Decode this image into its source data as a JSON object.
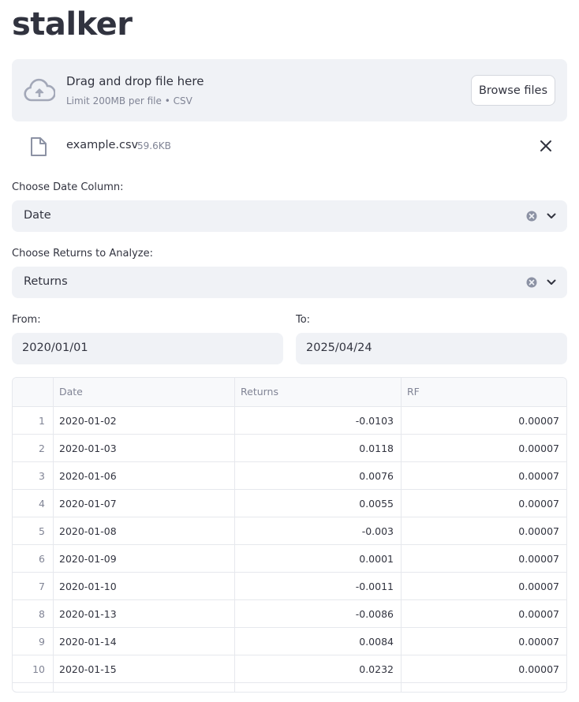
{
  "app": {
    "title": "stalker"
  },
  "uploader": {
    "main_text": "Drag and drop file here",
    "sub_text": "Limit 200MB per file • CSV",
    "browse_label": "Browse files"
  },
  "file": {
    "name": "example.csv",
    "size": "59.6KB"
  },
  "date_column": {
    "label": "Choose Date Column:",
    "value": "Date"
  },
  "returns_column": {
    "label": "Choose Returns to Analyze:",
    "value": "Returns"
  },
  "from": {
    "label": "From:",
    "value": "2020/01/01"
  },
  "to": {
    "label": "To:",
    "value": "2025/04/24"
  },
  "table": {
    "columns": [
      "Date",
      "Returns",
      "RF"
    ],
    "rows": [
      {
        "idx": "1",
        "date": "2020-01-02",
        "returns": "-0.0103",
        "rf": "0.00007"
      },
      {
        "idx": "2",
        "date": "2020-01-03",
        "returns": "0.0118",
        "rf": "0.00007"
      },
      {
        "idx": "3",
        "date": "2020-01-06",
        "returns": "0.0076",
        "rf": "0.00007"
      },
      {
        "idx": "4",
        "date": "2020-01-07",
        "returns": "0.0055",
        "rf": "0.00007"
      },
      {
        "idx": "5",
        "date": "2020-01-08",
        "returns": "-0.003",
        "rf": "0.00007"
      },
      {
        "idx": "6",
        "date": "2020-01-09",
        "returns": "0.0001",
        "rf": "0.00007"
      },
      {
        "idx": "7",
        "date": "2020-01-10",
        "returns": "-0.0011",
        "rf": "0.00007"
      },
      {
        "idx": "8",
        "date": "2020-01-13",
        "returns": "-0.0086",
        "rf": "0.00007"
      },
      {
        "idx": "9",
        "date": "2020-01-14",
        "returns": "0.0084",
        "rf": "0.00007"
      },
      {
        "idx": "10",
        "date": "2020-01-15",
        "returns": "0.0232",
        "rf": "0.00007"
      }
    ]
  }
}
